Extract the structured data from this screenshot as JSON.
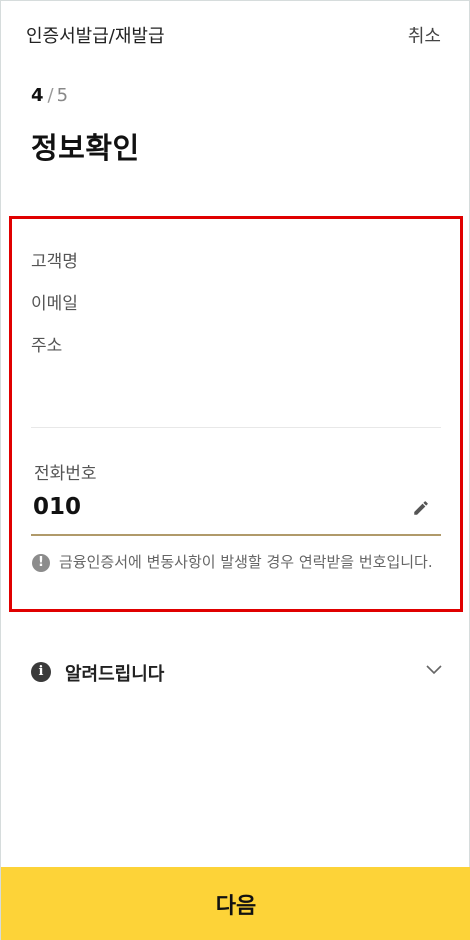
{
  "header": {
    "title": "인증서발급/재발급",
    "cancel_label": "취소"
  },
  "progress": {
    "current": "4",
    "separator": "/",
    "total": "5"
  },
  "page_title": "정보확인",
  "customer_info": {
    "name_label": "고객명",
    "email_label": "이메일",
    "address_label": "주소"
  },
  "phone": {
    "label": "전화번호",
    "value": "010",
    "notice": "금융인증서에 변동사항이 발생할 경우 연락받을 번호입니다."
  },
  "accordion": {
    "label": "알려드립니다"
  },
  "footer": {
    "next_label": "다음"
  },
  "colors": {
    "accent": "#fdd338",
    "underline": "#b09a6a",
    "highlight_border": "#e00000"
  },
  "icons": {
    "edit": "pencil-icon",
    "notice": "exclamation-circle-icon",
    "info": "info-circle-icon",
    "expand": "chevron-down-icon"
  }
}
